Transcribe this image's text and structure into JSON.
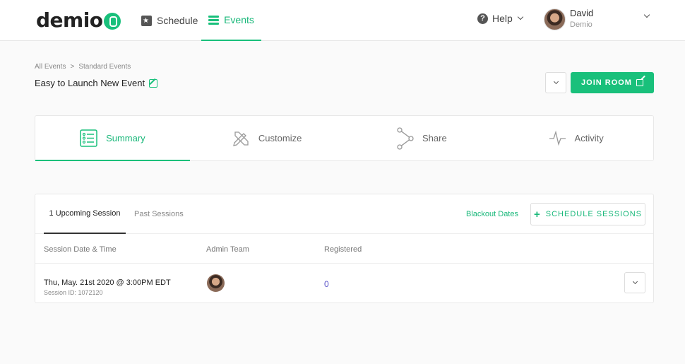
{
  "nav": {
    "logo": "demio",
    "items": [
      {
        "label": "Schedule",
        "icon": "calendar-star-icon"
      },
      {
        "label": "Events",
        "icon": "list-icon",
        "active": true
      }
    ],
    "help_label": "Help",
    "user": {
      "name": "David",
      "org": "Demio"
    }
  },
  "breadcrumb": {
    "items": [
      "All Events",
      "Standard Events"
    ],
    "separator": ">"
  },
  "event": {
    "title": "Easy to Launch New Event"
  },
  "actions": {
    "join_label": "JOIN ROOM"
  },
  "tabs": [
    {
      "label": "Summary",
      "icon": "summary-list-icon",
      "active": true
    },
    {
      "label": "Customize",
      "icon": "pencil-ruler-icon"
    },
    {
      "label": "Share",
      "icon": "share-icon"
    },
    {
      "label": "Activity",
      "icon": "activity-pulse-icon"
    }
  ],
  "sessions": {
    "tabs": [
      {
        "label": "1 Upcoming Session",
        "active": true
      },
      {
        "label": "Past Sessions"
      }
    ],
    "blackout_label": "Blackout Dates",
    "schedule_label": "SCHEDULE SESSIONS",
    "columns": [
      "Session Date & Time",
      "Admin Team",
      "Registered"
    ],
    "rows": [
      {
        "date": "Thu, May. 21st 2020 @ 3:00PM EDT",
        "session_id": "Session ID: 1072120",
        "registered": "0"
      }
    ]
  },
  "colors": {
    "accent": "#19c07b",
    "link_purple": "#5a53c8"
  }
}
